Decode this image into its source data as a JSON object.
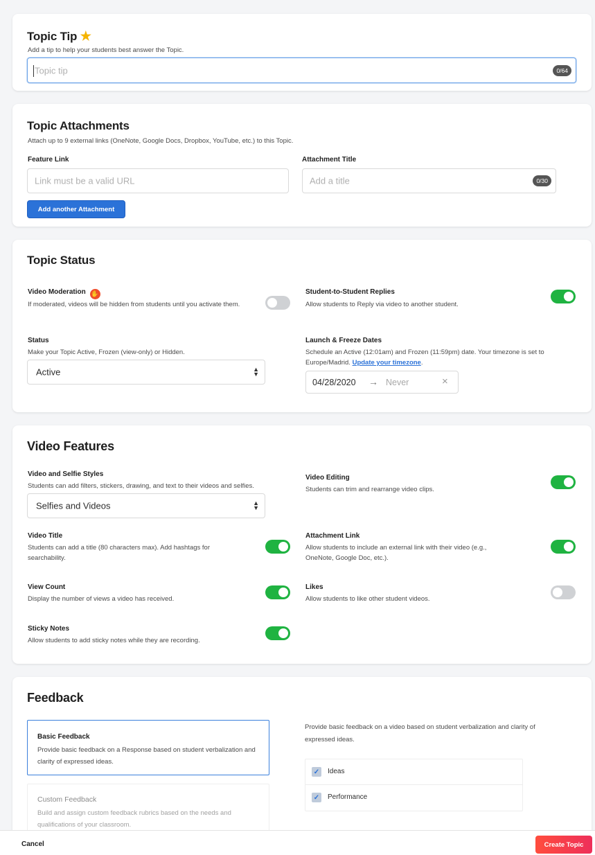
{
  "topic_tip": {
    "title": "Topic Tip",
    "star_icon": "★",
    "description": "Add a tip to help your students best answer the Topic.",
    "input_placeholder": "Topic tip",
    "input_value": "",
    "counter": "0/64"
  },
  "attachments": {
    "title": "Topic Attachments",
    "description": "Attach up to 9 external links (OneNote, Google Docs, Dropbox, YouTube, etc.) to this Topic.",
    "feature_link_label": "Feature Link",
    "feature_link_placeholder": "Link must be a valid URL",
    "attachment_title_label": "Attachment Title",
    "attachment_title_placeholder": "Add a title",
    "title_counter": "0/30",
    "add_button": "Add another Attachment"
  },
  "status": {
    "title": "Topic Status",
    "video_moderation_label": "Video Moderation",
    "video_moderation_desc": "If moderated, videos will be hidden from students until you activate them.",
    "video_moderation_on": false,
    "replies_label": "Student-to-Student Replies",
    "replies_desc": "Allow students to Reply via video to another student.",
    "replies_on": true,
    "status_label": "Status",
    "status_desc": "Make your Topic Active, Frozen (view-only) or Hidden.",
    "status_value": "Active",
    "dates_label": "Launch & Freeze Dates",
    "dates_desc": "Schedule an Active (12:01am) and Frozen (11:59pm) date. Your timezone is set to Europe/Madrid.",
    "dates_link": "Update your timezone",
    "dates_period": ".",
    "launch_date": "04/28/2020",
    "arrow": "→",
    "freeze_date": "Never",
    "clear_icon": "×"
  },
  "video_features": {
    "title": "Video Features",
    "styles_label": "Video and Selfie Styles",
    "styles_desc": "Students can add filters, stickers, drawing, and text to their videos and selfies.",
    "styles_value": "Selfies and Videos",
    "editing_label": "Video Editing",
    "editing_desc": "Students can trim and rearrange video clips.",
    "editing_on": true,
    "video_title_label": "Video Title",
    "video_title_desc": "Students can add a title (80 characters max). Add hashtags for searchability.",
    "video_title_on": true,
    "attachment_link_label": "Attachment Link",
    "attachment_link_desc": "Allow students to include an external link with their video (e.g., OneNote, Google Doc, etc.).",
    "attachment_link_on": true,
    "view_count_label": "View Count",
    "view_count_desc": "Display the number of views a video has received.",
    "view_count_on": true,
    "likes_label": "Likes",
    "likes_desc": "Allow students to like other student videos.",
    "likes_on": false,
    "sticky_label": "Sticky Notes",
    "sticky_desc": "Allow students to add sticky notes while they are recording.",
    "sticky_on": true
  },
  "feedback": {
    "title": "Feedback",
    "basic_title": "Basic Feedback",
    "basic_desc": "Provide basic feedback on a Response based on student verbalization and clarity of expressed ideas.",
    "custom_title": "Custom Feedback",
    "custom_desc": "Build and assign custom feedback rubrics based on the needs and qualifications of your classroom.",
    "right_desc": "Provide basic feedback on a video based on student verbalization and clarity of expressed ideas.",
    "check_mark": "✓",
    "options": [
      "Ideas",
      "Performance"
    ]
  },
  "footer": {
    "cancel": "Cancel",
    "create": "Create Topic"
  },
  "colors": {
    "accent_blue": "#2b72d8",
    "toggle_on": "#1fb341",
    "create_button": "#f0354a"
  }
}
